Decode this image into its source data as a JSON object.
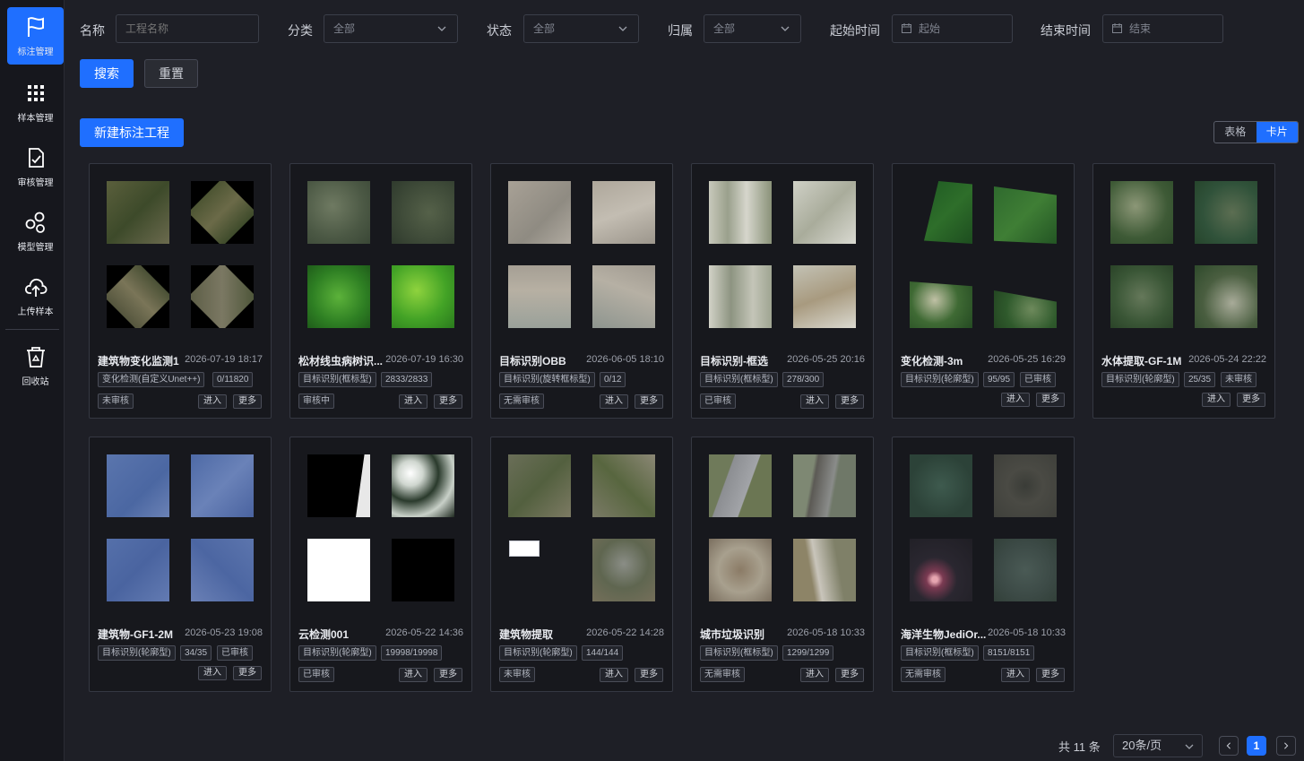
{
  "sidebar": {
    "items": [
      {
        "label": "标注管理",
        "icon": "flag-icon",
        "active": true
      },
      {
        "label": "样本管理",
        "icon": "grid-icon"
      },
      {
        "label": "审核管理",
        "icon": "document-check-icon"
      },
      {
        "label": "模型管理",
        "icon": "model-nodes-icon"
      },
      {
        "label": "上传样本",
        "icon": "cloud-upload-icon"
      },
      {
        "label": "回收站",
        "icon": "recycle-bin-icon"
      }
    ]
  },
  "filters": {
    "name_label": "名称",
    "name_placeholder": "工程名称",
    "category_label": "分类",
    "category_value": "全部",
    "status_label": "状态",
    "status_value": "全部",
    "owner_label": "归属",
    "owner_value": "全部",
    "start_label": "起始时间",
    "start_placeholder": "起始",
    "end_label": "结束时间",
    "end_placeholder": "结束",
    "search_button": "搜索",
    "reset_button": "重置"
  },
  "toolbar": {
    "new_project_button": "新建标注工程",
    "view_table": "表格",
    "view_card": "卡片"
  },
  "cards": [
    {
      "title": "建筑物变化监测1",
      "date": "2026-07-19 18:17",
      "type": "变化检测(自定义Unet++)",
      "progress": "0/11820",
      "status": "未审核",
      "enter": "进入",
      "more": "更多"
    },
    {
      "title": "松材线虫病树识...",
      "date": "2026-07-19 16:30",
      "type": "目标识别(框标型)",
      "progress": "2833/2833",
      "status": "审核中",
      "enter": "进入",
      "more": "更多"
    },
    {
      "title": "目标识别OBB",
      "date": "2026-06-05 18:10",
      "type": "目标识别(旋转框标型)",
      "progress": "0/12",
      "status": "无需审核",
      "enter": "进入",
      "more": "更多"
    },
    {
      "title": "目标识别-框选",
      "date": "2026-05-25 20:16",
      "type": "目标识别(框标型)",
      "progress": "278/300",
      "status": "已审核",
      "enter": "进入",
      "more": "更多"
    },
    {
      "title": "变化检测-3m",
      "date": "2026-05-25 16:29",
      "type": "目标识别(轮廓型)",
      "progress": "95/95",
      "status": "已审核",
      "enter": "进入",
      "more": "更多"
    },
    {
      "title": "水体提取-GF-1M",
      "date": "2026-05-24 22:22",
      "type": "目标识别(轮廓型)",
      "progress": "25/35",
      "status": "未审核",
      "enter": "进入",
      "more": "更多"
    },
    {
      "title": "建筑物-GF1-2M",
      "date": "2026-05-23 19:08",
      "type": "目标识别(轮廓型)",
      "progress": "34/35",
      "status": "已审核",
      "enter": "进入",
      "more": "更多"
    },
    {
      "title": "云检测001",
      "date": "2026-05-22 14:36",
      "type": "目标识别(轮廓型)",
      "progress": "19998/19998",
      "status": "已审核",
      "enter": "进入",
      "more": "更多"
    },
    {
      "title": "建筑物提取",
      "date": "2026-05-22 14:28",
      "type": "目标识别(轮廓型)",
      "progress": "144/144",
      "status": "未审核",
      "enter": "进入",
      "more": "更多"
    },
    {
      "title": "城市垃圾识别",
      "date": "2026-05-18 10:33",
      "type": "目标识别(框标型)",
      "progress": "1299/1299",
      "status": "无需审核",
      "enter": "进入",
      "more": "更多"
    },
    {
      "title": "海洋生物JediOr...",
      "date": "2026-05-18 10:33",
      "type": "目标识别(框标型)",
      "progress": "8151/8151",
      "status": "无需审核",
      "enter": "进入",
      "more": "更多"
    }
  ],
  "pagination": {
    "total": "共 11 条",
    "page_size": "20条/页",
    "current_page": "1"
  },
  "colors": {
    "accent": "#1f6fff",
    "background": "#1e1f26",
    "card_background": "#17181d"
  }
}
